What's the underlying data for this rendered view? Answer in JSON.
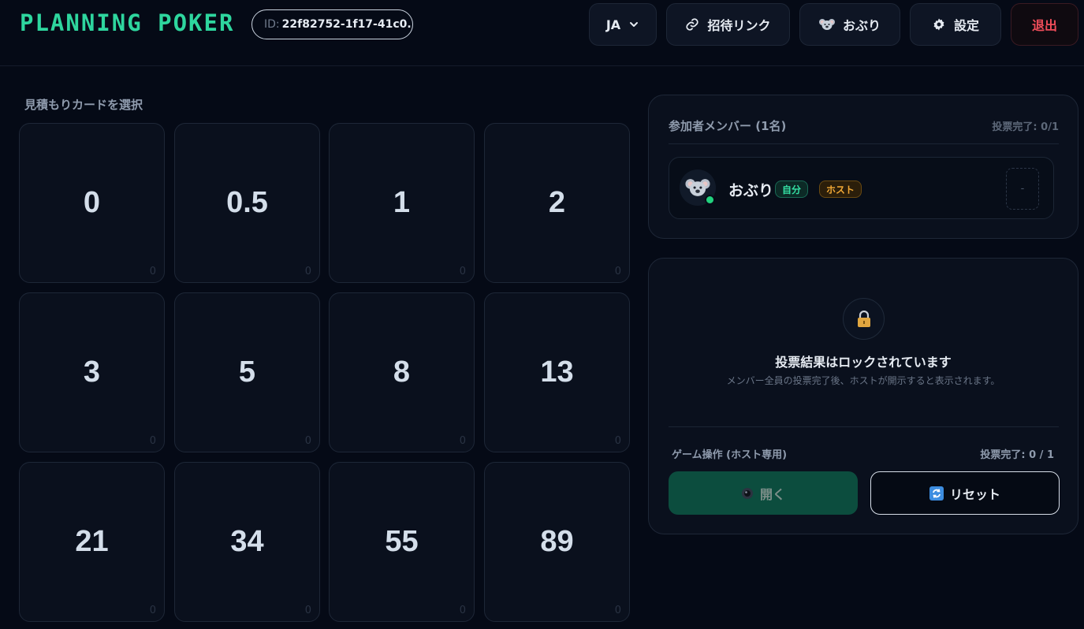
{
  "app": {
    "logo": "PLANNING POKER",
    "room_id_label": "ID:",
    "room_id_value": "22f82752-1f17-41c0..."
  },
  "header": {
    "lang_label": "JA",
    "invite_label": "招待リンク",
    "user_label": "おぶり",
    "settings_label": "設定",
    "exit_label": "退出"
  },
  "cards": {
    "title": "見積もりカードを選択",
    "items": [
      {
        "value": "0",
        "count": "0"
      },
      {
        "value": "0.5",
        "count": "0"
      },
      {
        "value": "1",
        "count": "0"
      },
      {
        "value": "2",
        "count": "0"
      },
      {
        "value": "3",
        "count": "0"
      },
      {
        "value": "5",
        "count": "0"
      },
      {
        "value": "8",
        "count": "0"
      },
      {
        "value": "13",
        "count": "0"
      },
      {
        "value": "21",
        "count": "0"
      },
      {
        "value": "34",
        "count": "0"
      },
      {
        "value": "55",
        "count": "0"
      },
      {
        "value": "89",
        "count": "0"
      }
    ]
  },
  "members": {
    "title": "参加者メンバー (1名)",
    "vote_status": "投票完了: 0/1",
    "list": [
      {
        "name": "おぶり",
        "badge_self": "自分",
        "badge_host": "ホスト",
        "vote": "-",
        "avatar_icon": "koala-icon",
        "online": true
      }
    ]
  },
  "results": {
    "locked_title": "投票結果はロックされています",
    "locked_desc": "メンバー全員の投票完了後、ホストが開示すると表示されます。",
    "ops_title": "ゲーム操作 (ホスト専用)",
    "ops_status": "投票完了: 0 / 1",
    "open_label": "開く",
    "reset_label": "リセット"
  },
  "colors": {
    "accent": "#2ed69e",
    "background": "#050a16",
    "exit": "#ef4d5a",
    "host_badge": "#f1a836",
    "open_button": "#0c4d3e"
  }
}
